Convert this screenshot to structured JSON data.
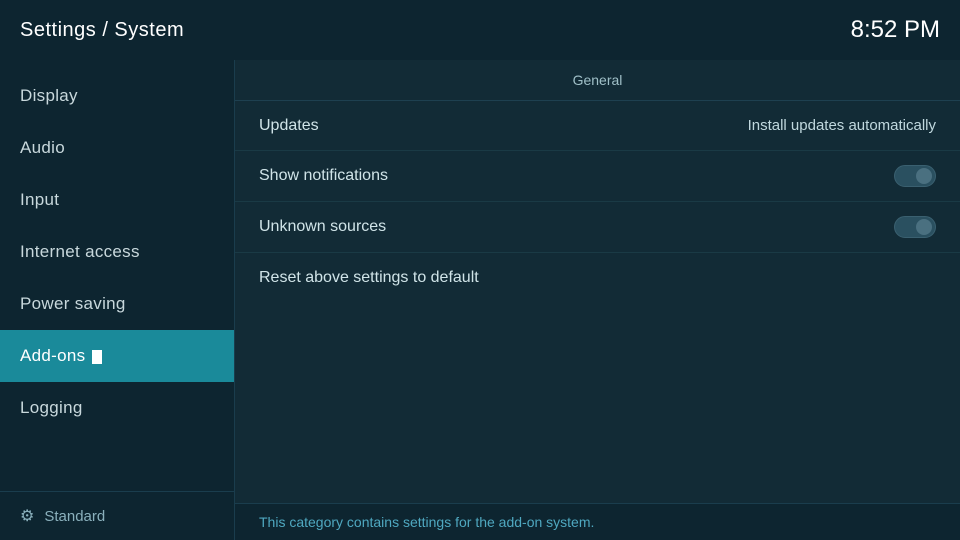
{
  "header": {
    "title": "Settings / System",
    "time": "8:52 PM"
  },
  "sidebar": {
    "items": [
      {
        "id": "display",
        "label": "Display",
        "active": false
      },
      {
        "id": "audio",
        "label": "Audio",
        "active": false
      },
      {
        "id": "input",
        "label": "Input",
        "active": false
      },
      {
        "id": "internet-access",
        "label": "Internet access",
        "active": false
      },
      {
        "id": "power-saving",
        "label": "Power saving",
        "active": false
      },
      {
        "id": "add-ons",
        "label": "Add-ons",
        "active": true
      },
      {
        "id": "logging",
        "label": "Logging",
        "active": false
      }
    ],
    "footer_label": "Standard"
  },
  "content": {
    "section_header": "General",
    "rows": [
      {
        "id": "updates",
        "label": "Updates",
        "value": "Install updates automatically",
        "has_toggle": false
      },
      {
        "id": "show-notifications",
        "label": "Show notifications",
        "value": "",
        "has_toggle": true,
        "toggle_state": "off"
      },
      {
        "id": "unknown-sources",
        "label": "Unknown sources",
        "value": "",
        "has_toggle": true,
        "toggle_state": "off"
      },
      {
        "id": "reset-settings",
        "label": "Reset above settings to default",
        "value": "",
        "has_toggle": false
      }
    ],
    "status_text": "This category contains settings for the add-on system."
  }
}
